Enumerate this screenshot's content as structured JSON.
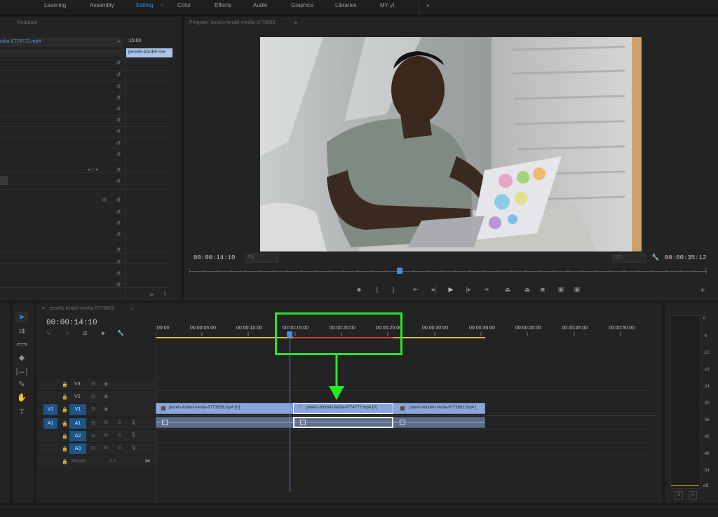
{
  "workspace": {
    "tabs": [
      "Learning",
      "Assembly",
      "Editing",
      "Color",
      "Effects",
      "Audio",
      "Graphics",
      "Libraries",
      "MY yt"
    ],
    "active": "Editing",
    "more": "»"
  },
  "source_panel": {
    "tab_label": "Metadata",
    "clip_name": "edia-6774772.mp4",
    "timecode": ":15:00",
    "mini_clip": "pexels-kindel-me"
  },
  "program_monitor": {
    "title": "Program: pexels-kindel-media-6773862",
    "current_timecode": "00:00:14:10",
    "duration_timecode": "00:00:35:12",
    "fit_label": "Fit",
    "quality_label": "1/2"
  },
  "timeline": {
    "sequence_tab": "pexels-kindel-media-6773862",
    "timecode": "00:00:14:10",
    "ruler_labels": [
      ":00:00",
      "00:00:05:00",
      "00:00:10:00",
      "00:00:15:00",
      "00:00:20:00",
      "00:00:25:00",
      "00:00:30:00",
      "00:00:35:00",
      "00:00:40:00",
      "00:00:45:00",
      "00:00:50:00"
    ],
    "tracks": {
      "V3": "V3",
      "V2": "V2",
      "V1": "V1",
      "A1": "A1",
      "A2": "A2",
      "A3": "A3",
      "master": "Master",
      "master_value": "0.0"
    },
    "source_patch": {
      "v1": "V1",
      "a1": "A1"
    },
    "clips": [
      {
        "name": "pexels-kindel-media-6773858.mp4 [V]"
      },
      {
        "name": "pexels-kindel-media-6774772.mp4 [V]",
        "fx": "fx"
      },
      {
        "name": "pexels-kindel-media-6773862.mp4 ["
      }
    ]
  },
  "meter": {
    "scale": [
      "0",
      "-6",
      "-12",
      "-18",
      "-24",
      "-30",
      "-36",
      "-42",
      "-48",
      "-54",
      "dB"
    ],
    "solo_buttons": [
      "S",
      "S"
    ]
  },
  "colors": {
    "accent": "#2f8fe0",
    "highlight_box": "#27e627",
    "clip_video": "#8aa6db",
    "clip_audio": "#5c6d8b",
    "playhead": "#3d8ee6"
  }
}
